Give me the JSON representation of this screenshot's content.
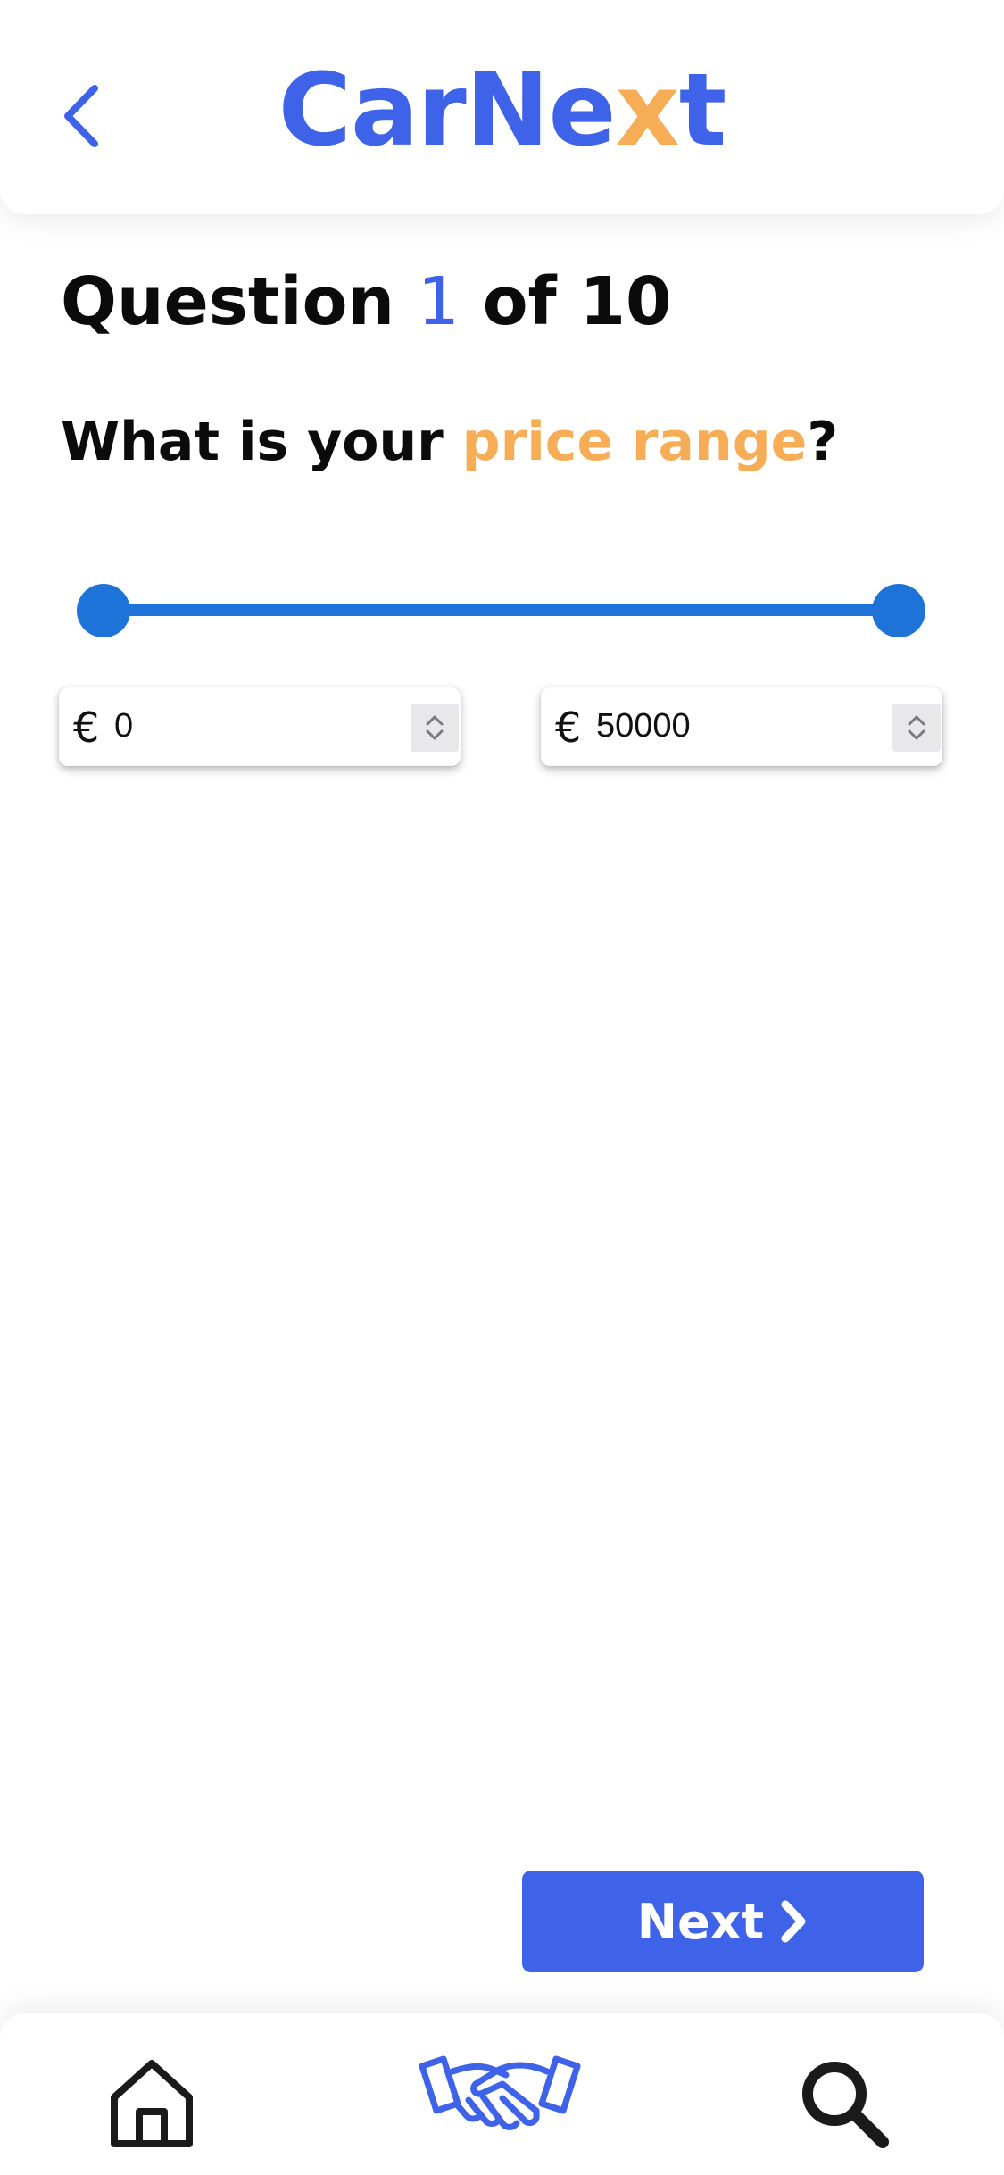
{
  "header": {
    "logo_part1": "CarNe",
    "logo_part2": "x",
    "logo_part3": "t",
    "back_icon": "chevron-left-icon"
  },
  "question": {
    "prefix": "Question ",
    "current": "1",
    "suffix": " of 10",
    "text_before": "What is your ",
    "text_highlight": "price range",
    "text_after": "?"
  },
  "price_range": {
    "min": 0,
    "max": 50000,
    "selected_min_fraction": 0,
    "selected_max_fraction": 1,
    "currency_symbol": "€",
    "min_value": "0",
    "max_value": "50000"
  },
  "actions": {
    "next_label": "Next",
    "next_icon": "chevron-right-icon"
  },
  "bottom_nav": {
    "items": [
      {
        "icon": "home-icon"
      },
      {
        "icon": "handshake-icon"
      },
      {
        "icon": "search-icon"
      }
    ]
  },
  "colors": {
    "brand_blue": "#3f63e8",
    "accent_orange": "#f6ad55",
    "slider_blue": "#1e73d8"
  }
}
